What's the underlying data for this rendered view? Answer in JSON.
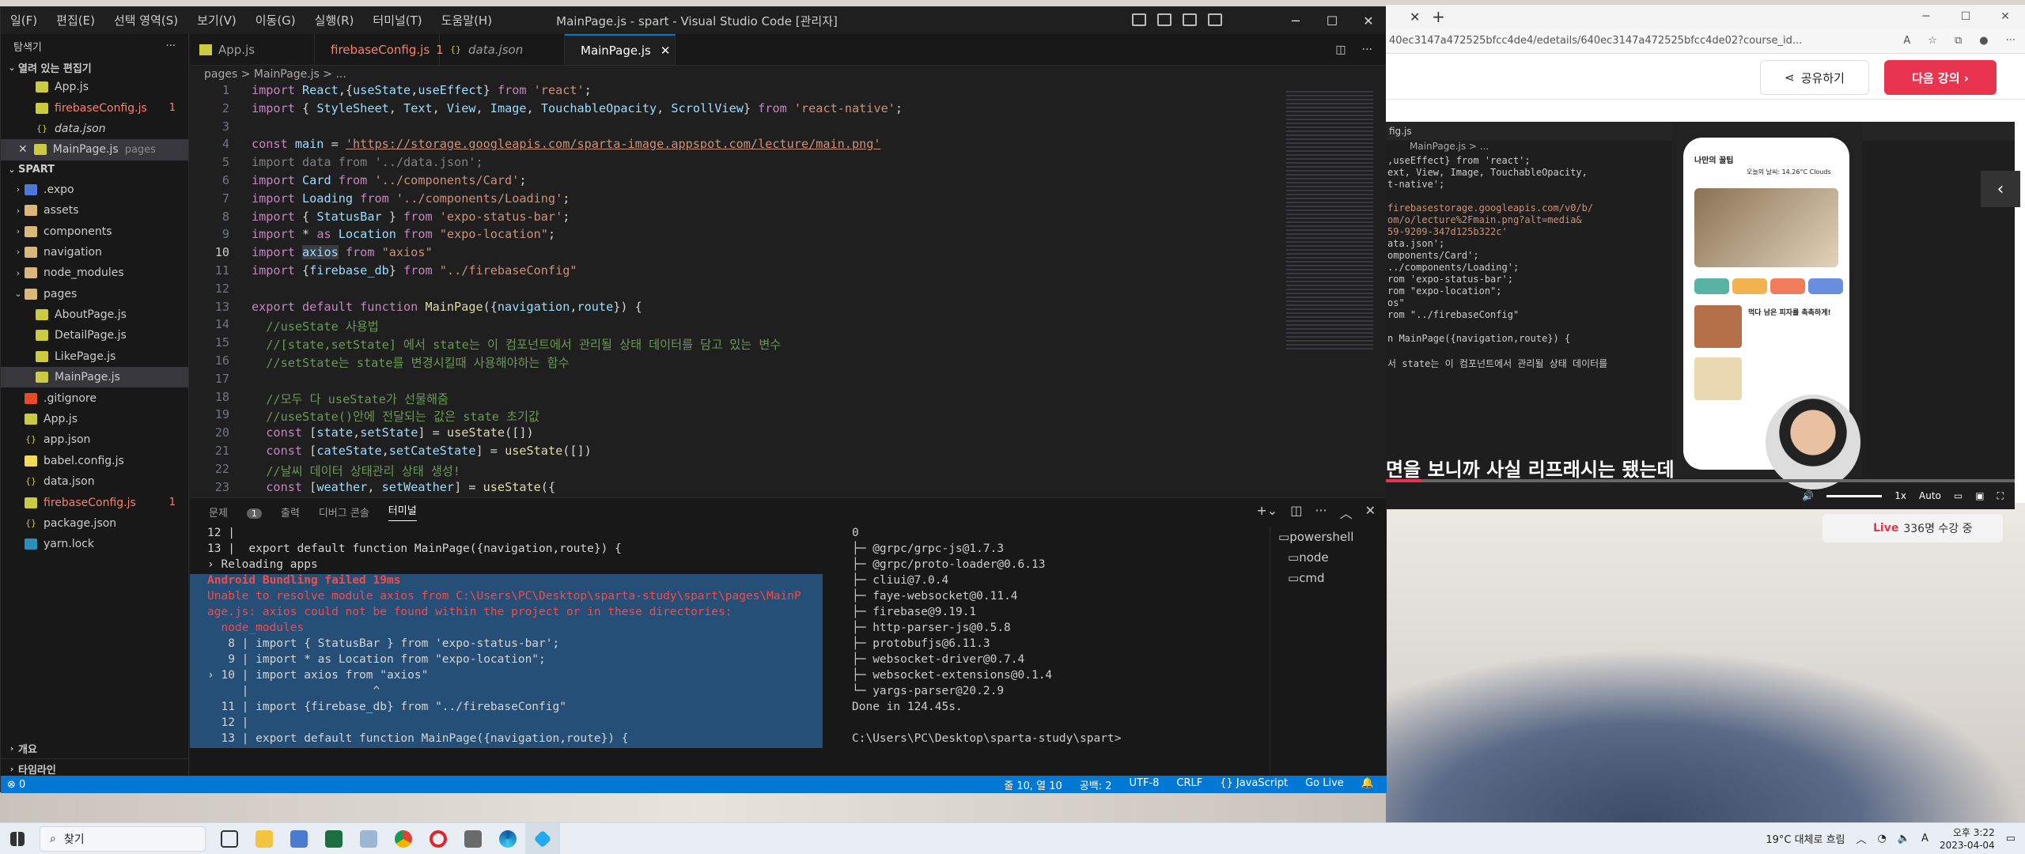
{
  "vscode": {
    "menu": [
      "일(F)",
      "편집(E)",
      "선택 영역(S)",
      "보기(V)",
      "이동(G)",
      "실행(R)",
      "터미널(T)",
      "도움말(H)"
    ],
    "title": "MainPage.js - spart - Visual Studio Code [관리자]",
    "sidebar": {
      "header": "탐색기",
      "open_editors": "열려 있는 편집기",
      "open_files": [
        {
          "name": "App.js",
          "type": "js"
        },
        {
          "name": "firebaseConfig.js",
          "type": "js",
          "error": "1"
        },
        {
          "name": "data.json",
          "type": "json"
        },
        {
          "name": "MainPage.js",
          "type": "js",
          "note": "pages",
          "selected": true
        }
      ],
      "project": "SPART",
      "tree": [
        {
          "name": ".expo",
          "kind": "folder",
          "icon": "expo"
        },
        {
          "name": "assets",
          "kind": "folder"
        },
        {
          "name": "components",
          "kind": "folder"
        },
        {
          "name": "navigation",
          "kind": "folder"
        },
        {
          "name": "node_modules",
          "kind": "folder"
        },
        {
          "name": "pages",
          "kind": "folder-open"
        },
        {
          "name": "AboutPage.js",
          "kind": "js",
          "indent": 2
        },
        {
          "name": "DetailPage.js",
          "kind": "js",
          "indent": 2
        },
        {
          "name": "LikePage.js",
          "kind": "js",
          "indent": 2
        },
        {
          "name": "MainPage.js",
          "kind": "js",
          "indent": 2,
          "selected": true
        },
        {
          "name": ".gitignore",
          "kind": "git"
        },
        {
          "name": "App.js",
          "kind": "js"
        },
        {
          "name": "app.json",
          "kind": "json"
        },
        {
          "name": "babel.config.js",
          "kind": "babel"
        },
        {
          "name": "data.json",
          "kind": "json"
        },
        {
          "name": "firebaseConfig.js",
          "kind": "js",
          "error": "1"
        },
        {
          "name": "package.json",
          "kind": "json"
        },
        {
          "name": "yarn.lock",
          "kind": "yarn"
        }
      ],
      "outline": "개요",
      "timeline": "타임라인"
    },
    "tabs": [
      {
        "label": "App.js"
      },
      {
        "label": "firebaseConfig.js",
        "error": "1"
      },
      {
        "label": "data.json"
      },
      {
        "label": "MainPage.js",
        "active": true
      }
    ],
    "breadcrumb": "pages > MainPage.js > ...",
    "code": [
      {
        "n": "1",
        "s": [
          [
            "kw",
            "import "
          ],
          [
            "v",
            "React"
          ],
          [
            "p",
            ",{"
          ],
          [
            "v",
            "useState"
          ],
          [
            "p",
            ","
          ],
          [
            "v",
            "useEffect"
          ],
          [
            "p",
            "} "
          ],
          [
            "kw",
            "from "
          ],
          [
            "str",
            "'react'"
          ],
          [
            "p",
            ";"
          ]
        ]
      },
      {
        "n": "2",
        "s": [
          [
            "kw",
            "import "
          ],
          [
            "p",
            "{ "
          ],
          [
            "v",
            "StyleSheet"
          ],
          [
            "p",
            ", "
          ],
          [
            "v",
            "Text"
          ],
          [
            "p",
            ", "
          ],
          [
            "v",
            "View"
          ],
          [
            "p",
            ", "
          ],
          [
            "v",
            "Image"
          ],
          [
            "p",
            ", "
          ],
          [
            "v",
            "TouchableOpacity"
          ],
          [
            "p",
            ", "
          ],
          [
            "v",
            "ScrollView"
          ],
          [
            "p",
            "} "
          ],
          [
            "kw",
            "from "
          ],
          [
            "str",
            "'react-native'"
          ],
          [
            "p",
            ";"
          ]
        ]
      },
      {
        "n": "3",
        "s": []
      },
      {
        "n": "4",
        "s": [
          [
            "kw",
            "const "
          ],
          [
            "v",
            "main"
          ],
          [
            "p",
            " = "
          ],
          [
            "url",
            "'https://storage.googleapis.com/sparta-image.appspot.com/lecture/main.png'"
          ]
        ]
      },
      {
        "n": "5",
        "s": [
          [
            "dim",
            "import data from '../data.json';"
          ]
        ]
      },
      {
        "n": "6",
        "s": [
          [
            "kw",
            "import "
          ],
          [
            "v",
            "Card"
          ],
          [
            "kw",
            " from "
          ],
          [
            "str",
            "'../components/Card'"
          ],
          [
            "p",
            ";"
          ]
        ]
      },
      {
        "n": "7",
        "s": [
          [
            "kw",
            "import "
          ],
          [
            "v",
            "Loading"
          ],
          [
            "kw",
            " from "
          ],
          [
            "str",
            "'../components/Loading'"
          ],
          [
            "p",
            ";"
          ]
        ]
      },
      {
        "n": "8",
        "s": [
          [
            "kw",
            "import "
          ],
          [
            "p",
            "{ "
          ],
          [
            "v",
            "StatusBar"
          ],
          [
            "p",
            " } "
          ],
          [
            "kw",
            "from "
          ],
          [
            "str",
            "'expo-status-bar'"
          ],
          [
            "p",
            ";"
          ]
        ]
      },
      {
        "n": "9",
        "s": [
          [
            "kw",
            "import "
          ],
          [
            "p",
            "* "
          ],
          [
            "kw",
            "as "
          ],
          [
            "v",
            "Location"
          ],
          [
            "kw",
            " from "
          ],
          [
            "str",
            "\"expo-location\""
          ],
          [
            "p",
            ";"
          ]
        ]
      },
      {
        "n": "10",
        "s": [
          [
            "kw",
            "import "
          ],
          [
            "hl",
            "axios"
          ],
          [
            "kw",
            " from "
          ],
          [
            "str",
            "\"axios\""
          ]
        ],
        "cur": true
      },
      {
        "n": "11",
        "s": [
          [
            "kw",
            "import "
          ],
          [
            "p",
            "{"
          ],
          [
            "v",
            "firebase_db"
          ],
          [
            "p",
            "} "
          ],
          [
            "kw",
            "from "
          ],
          [
            "str",
            "\"../firebaseConfig\""
          ]
        ]
      },
      {
        "n": "12",
        "s": []
      },
      {
        "n": "13",
        "s": [
          [
            "kw",
            "export default function "
          ],
          [
            "fn",
            "MainPage"
          ],
          [
            "p",
            "({"
          ],
          [
            "v",
            "navigation"
          ],
          [
            "p",
            ","
          ],
          [
            "v",
            "route"
          ],
          [
            "p",
            "}) {"
          ]
        ]
      },
      {
        "n": "14",
        "s": [
          [
            "cm",
            "  //useState 사용법"
          ]
        ]
      },
      {
        "n": "15",
        "s": [
          [
            "cm",
            "  //[state,setState] 에서 state는 이 컴포넌트에서 관리될 상태 데이터를 담고 있는 변수"
          ]
        ]
      },
      {
        "n": "16",
        "s": [
          [
            "cm",
            "  //setState는 state를 변경시킬때 사용해야하는 함수"
          ]
        ]
      },
      {
        "n": "17",
        "s": []
      },
      {
        "n": "18",
        "s": [
          [
            "cm",
            "  //모두 다 useState가 선물해줌"
          ]
        ]
      },
      {
        "n": "19",
        "s": [
          [
            "cm",
            "  //useState()안에 전달되는 값은 state 초기값"
          ]
        ]
      },
      {
        "n": "20",
        "s": [
          [
            "kw",
            "  const "
          ],
          [
            "p",
            "["
          ],
          [
            "v",
            "state"
          ],
          [
            "p",
            ","
          ],
          [
            "v",
            "setState"
          ],
          [
            "p",
            "] = "
          ],
          [
            "fn",
            "useState"
          ],
          [
            "p",
            "([])"
          ]
        ]
      },
      {
        "n": "21",
        "s": [
          [
            "kw",
            "  const "
          ],
          [
            "p",
            "["
          ],
          [
            "v",
            "cateState"
          ],
          [
            "p",
            ","
          ],
          [
            "v",
            "setCateState"
          ],
          [
            "p",
            "] = "
          ],
          [
            "fn",
            "useState"
          ],
          [
            "p",
            "([])"
          ]
        ]
      },
      {
        "n": "22",
        "s": [
          [
            "cm",
            "  //날씨 데이터 상태관리 상태 생성!"
          ]
        ]
      },
      {
        "n": "23",
        "s": [
          [
            "kw",
            "  const "
          ],
          [
            "p",
            "["
          ],
          [
            "v",
            "weather"
          ],
          [
            "p",
            ", "
          ],
          [
            "v",
            "setWeather"
          ],
          [
            "p",
            "] = "
          ],
          [
            "fn",
            "useState"
          ],
          [
            "p",
            "({"
          ]
        ]
      }
    ],
    "panel": {
      "tabs": [
        "문제",
        "출력",
        "디버그 콘솔",
        "터미널"
      ],
      "problems_count": "1",
      "term1": [
        {
          "t": "12 |",
          "c": "p"
        },
        {
          "t": "13 |  export default function MainPage({navigation,route}) {",
          "c": "p"
        },
        {
          "t": "› Reloading apps",
          "c": "p"
        },
        {
          "t": "Android Bundling failed 19ms",
          "c": "err",
          "hl": true
        },
        {
          "t": "Unable to resolve module axios from C:\\Users\\PC\\Desktop\\sparta-study\\spart\\pages\\MainP",
          "c": "err",
          "hl": true
        },
        {
          "t": "age.js: axios could not be found within the project or in these directories:",
          "c": "err",
          "hl": true
        },
        {
          "t": "  node_modules",
          "c": "err",
          "hl": true
        },
        {
          "t": "   8 | import { StatusBar } from 'expo-status-bar';",
          "c": "p",
          "hl": true
        },
        {
          "t": "   9 | import * as Location from \"expo-location\";",
          "c": "p",
          "hl": true
        },
        {
          "t": "› 10 | import axios from \"axios\"",
          "c": "p",
          "hl": true
        },
        {
          "t": "     |                  ^",
          "c": "p",
          "hl": true
        },
        {
          "t": "  11 | import {firebase_db} from \"../firebaseConfig\"",
          "c": "p",
          "hl": true
        },
        {
          "t": "  12 |",
          "c": "p",
          "hl": true
        },
        {
          "t": "  13 | export default function MainPage({navigation,route}) {",
          "c": "p",
          "hl": true
        }
      ],
      "term2": [
        "0",
        "├─ @grpc/grpc-js@1.7.3",
        "├─ @grpc/proto-loader@0.6.13",
        "├─ cliui@7.0.4",
        "├─ faye-websocket@0.11.4",
        "├─ firebase@9.19.1",
        "├─ http-parser-js@0.5.8",
        "├─ protobufjs@6.11.3",
        "├─ websocket-driver@0.7.4",
        "├─ websocket-extensions@0.1.4",
        "└─ yargs-parser@20.2.9",
        "Done in 124.45s.",
        "",
        "C:\\Users\\PC\\Desktop\\sparta-study\\spart>"
      ],
      "terminals": [
        "powershell",
        "node",
        "cmd"
      ]
    },
    "status": {
      "left": "⊗ 0",
      "position": "줄 10, 열 10",
      "spaces": "공백: 2",
      "encoding": "UTF-8",
      "eol": "CRLF",
      "lang": "{} JavaScript",
      "golive": "Go Live"
    }
  },
  "browser": {
    "url": "40ec3147a472525bfcc4de4/edetails/640ec3147a472525bfcc4de02?course_id...",
    "share": "공유하기",
    "next": "다음 강의 ›",
    "video_code": [
      ",useEffect} from 'react';",
      "ext, View, Image, TouchableOpacity,",
      "t-native';",
      "",
      "firebasestorage.googleapis.com/v0/b/",
      "om/o/lecture%2Fmain.png?alt=media&",
      "59-9209-347d125b322c'",
      "ata.json';",
      "omponents/Card';",
      "../components/Loading';",
      "rom 'expo-status-bar';",
      "rom \"expo-location\";",
      "os\"",
      "rom \"../firebaseConfig\"",
      "",
      "n MainPage({navigation,route}) {",
      "",
      "서 state는 이 컴포넌트에서 관리될 상태 데이터를"
    ],
    "vtab": "fig.js",
    "vcrumb": "MainPage.js > ...",
    "phone": {
      "header": "나만의 꿀팁",
      "weather": "오늘의 날씨: 14.26°C   Clouds",
      "card_title": "먹다 남은 피자를 촉촉하게!"
    },
    "subtitle": "면을 보니까 사실 리프래시는 됐는데",
    "vctl": [
      "1x",
      "Auto"
    ],
    "live": "Live",
    "live_count": "336명 수강 중"
  },
  "taskbar": {
    "search": "찾기",
    "weather": "19°C 대체로 흐림",
    "time": "오후 3:22",
    "date": "2023-04-04"
  }
}
